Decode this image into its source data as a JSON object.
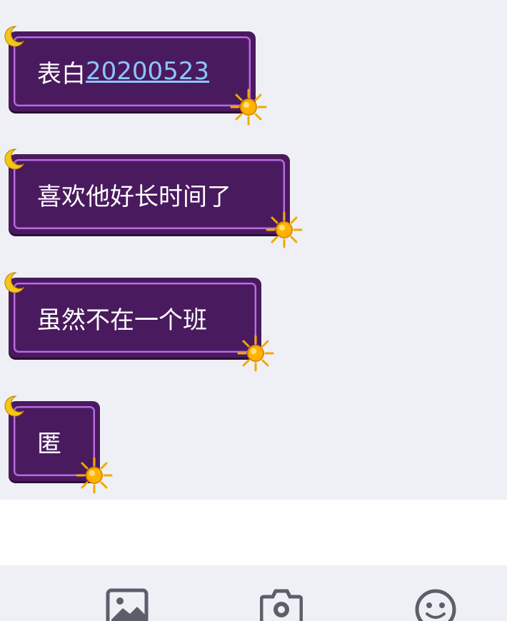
{
  "messages": [
    {
      "text": "表白",
      "link": "20200523"
    },
    {
      "text": "喜欢他好长时间了",
      "link": ""
    },
    {
      "text": "虽然不在一个班",
      "link": ""
    },
    {
      "text": "匿",
      "link": ""
    }
  ],
  "bubble_style": {
    "background": "#4a1a5e",
    "frame": "#b86fe0",
    "moon": "#f5c518",
    "sun": "#f7b500",
    "link": "#8ec5ff"
  },
  "toolbar": {
    "icons": [
      "image-icon",
      "camera-icon",
      "emoji-icon"
    ]
  }
}
